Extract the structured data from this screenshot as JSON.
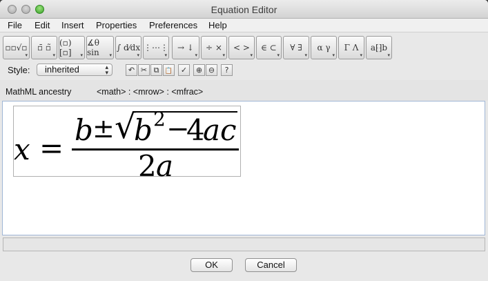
{
  "window": {
    "title": "Equation Editor"
  },
  "menubar": {
    "items": [
      "File",
      "Edit",
      "Insert",
      "Properties",
      "Preferences",
      "Help"
    ]
  },
  "palette": {
    "groups": [
      {
        "glyph": "▫▫√▫",
        "icon": "script-radical-palette-icon"
      },
      {
        "glyph": "▫̄ ▫̃",
        "icon": "accent-palette-icon"
      },
      {
        "glyph": "(▫) [▫]",
        "icon": "fence-palette-icon"
      },
      {
        "glyph": "∡θ sin",
        "icon": "function-palette-icon"
      },
      {
        "glyph": "∫ d⁄dx",
        "icon": "calculus-palette-icon"
      },
      {
        "glyph": "⋮⋯⋮",
        "icon": "matrix-palette-icon"
      },
      {
        "glyph": "→ ↓",
        "icon": "arrow-palette-icon"
      },
      {
        "glyph": "÷ ×",
        "icon": "operator-palette-icon"
      },
      {
        "glyph": "< >",
        "icon": "relation-palette-icon"
      },
      {
        "glyph": "∈ ⊂",
        "icon": "set-palette-icon"
      },
      {
        "glyph": "∀ ∃",
        "icon": "logic-palette-icon"
      },
      {
        "glyph": "α γ",
        "icon": "greek-lower-palette-icon"
      },
      {
        "glyph": "Γ Λ",
        "icon": "greek-upper-palette-icon"
      },
      {
        "glyph": "a⁅⁆b",
        "icon": "spacing-palette-icon"
      }
    ]
  },
  "style": {
    "label": "Style:",
    "value": "inherited"
  },
  "tools": [
    {
      "glyph": "↶",
      "icon": "undo-icon"
    },
    {
      "glyph": "✂",
      "icon": "cut-icon"
    },
    {
      "glyph": "⧉",
      "icon": "copy-icon"
    },
    {
      "glyph": "📋",
      "icon": "paste-icon"
    },
    {
      "glyph": "✓",
      "icon": "check-icon"
    },
    {
      "glyph": "⊕",
      "icon": "zoom-in-icon"
    },
    {
      "glyph": "⊖",
      "icon": "zoom-out-icon"
    },
    {
      "glyph": "?",
      "icon": "help-icon"
    }
  ],
  "ancestry": {
    "label": "MathML ancestry",
    "path": "<math> : <mrow> : <mfrac>"
  },
  "equation": {
    "lhs": "x",
    "equals": "=",
    "numerator_b": "b",
    "pm": "±",
    "radical": "√",
    "radicand_b": "b",
    "exponent": "2",
    "minus": "−",
    "four": "4",
    "ac": "ac",
    "denominator": "2",
    "denom_a": "a"
  },
  "buttons": {
    "ok": "OK",
    "cancel": "Cancel"
  }
}
